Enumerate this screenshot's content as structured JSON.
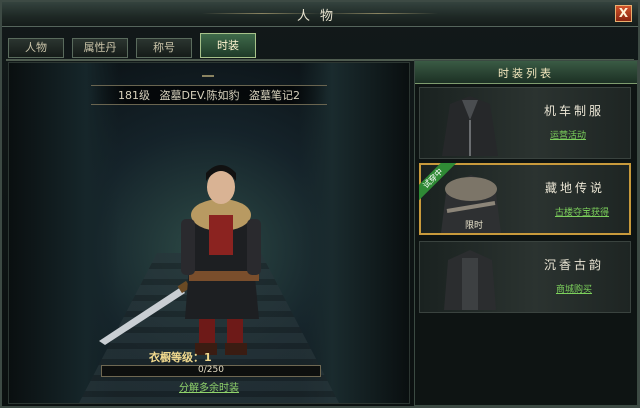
{
  "window": {
    "title": "人物",
    "close_label": "X"
  },
  "tabs": [
    {
      "label": "人物",
      "active": false
    },
    {
      "label": "属性丹",
      "active": false
    },
    {
      "label": "称号",
      "active": false
    },
    {
      "label": "时装",
      "active": true
    }
  ],
  "character": {
    "info_line": "181级 盗墓DEV.陈如豹 盗墓笔记2",
    "level_label": "衣橱等级：1",
    "progress": {
      "text": "0/250",
      "current": 0,
      "max": 250
    },
    "decompose_label": "分解多余时装"
  },
  "fashion_list": {
    "title": "时装列表",
    "items": [
      {
        "name": "机车制服",
        "link": "运营活动",
        "badge": "",
        "tag": ""
      },
      {
        "name": "藏地传说",
        "link": "古楼夺宝获得",
        "badge": "试穿中",
        "tag": "限时",
        "selected": true
      },
      {
        "name": "沉香古韵",
        "link": "商城购买",
        "badge": "",
        "tag": ""
      }
    ]
  },
  "colors": {
    "accent": "#c89a3c",
    "link": "#7cd05c",
    "badge": "#2f8a35"
  }
}
